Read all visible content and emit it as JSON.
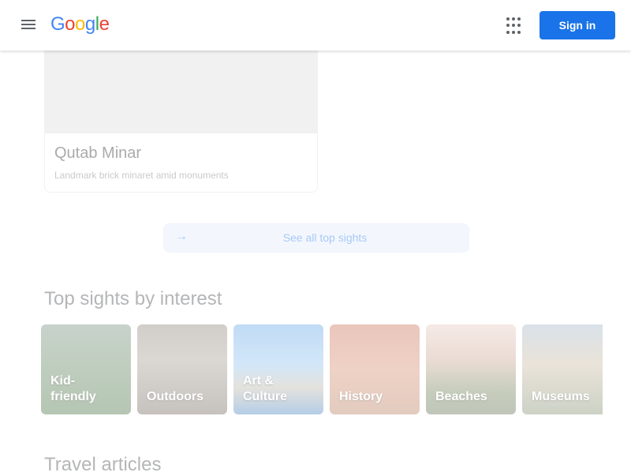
{
  "header": {
    "logo": {
      "G": "G",
      "o1": "o",
      "o2": "o",
      "g": "g",
      "l": "l",
      "e": "e"
    },
    "menu_icon": "hamburger-menu-icon",
    "apps_icon": "apps-grid-icon",
    "signin_label": "Sign in"
  },
  "card": {
    "title": "Qutab Minar",
    "subtitle": "Landmark brick minaret amid monuments"
  },
  "see_all": {
    "arrow_icon": "arrow-right-icon",
    "label": "See all top sights"
  },
  "interest": {
    "title": "Top sights by interest",
    "tiles": [
      {
        "label": "Kid-\nfriendly"
      },
      {
        "label": "Outdoors"
      },
      {
        "label": "Art &\nCulture"
      },
      {
        "label": "History"
      },
      {
        "label": "Beaches"
      },
      {
        "label": "Museums"
      }
    ]
  },
  "articles": {
    "title": "Travel articles"
  },
  "colors": {
    "brand_blue": "#1a73e8",
    "logo_blue": "#4285f4",
    "logo_red": "#ea4335",
    "logo_yellow": "#fbbc05",
    "logo_green": "#34a853"
  }
}
